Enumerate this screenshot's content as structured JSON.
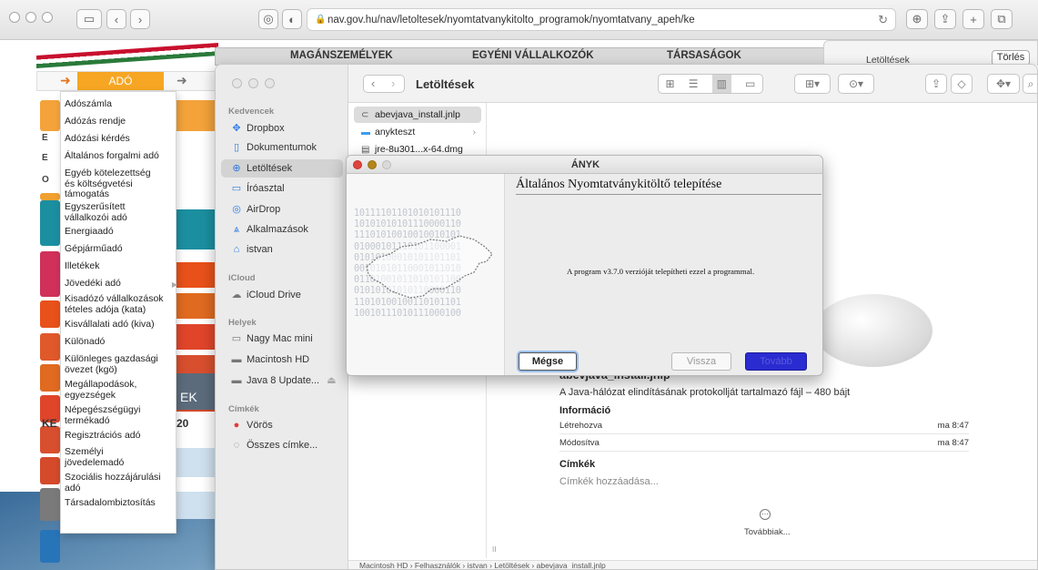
{
  "browser": {
    "url": "nav.gov.hu/nav/letoltesek/nyomtatvanykitolto_programok/nyomtatvany_apeh/ke"
  },
  "downloads_popover": {
    "title": "Letöltések",
    "clear_label": "Törlés"
  },
  "site": {
    "nav_items": [
      "MAGÁNSZEMÉLYEK",
      "EGYÉNI VÁLLALKOZÓK",
      "TÁRSASÁGOK"
    ],
    "ado_tab": "ADÓ",
    "side_letters": [
      "E",
      "E",
      "O"
    ],
    "fragments": [
      "KE",
      "20",
      "EK"
    ]
  },
  "menu": {
    "items": [
      "Adószámla",
      "Adózás rendje",
      "Adózási kérdés",
      "Általános forgalmi adó",
      "Egyéb kötelezettség és költségvetési támogatás",
      "Egyszerűsített vállalkozói adó",
      "Energiaadó",
      "Gépjárműadó",
      "Illetékek",
      "Jövedéki adó",
      "Kisadózó vállalkozások tételes adója (kata)",
      "Kisvállalati adó (kiva)",
      "Különadó",
      "Különleges gazdasági övezet (kgö)",
      "Megállapodások, egyezségek",
      "Népegészségügyi termékadó",
      "Regisztrációs adó",
      "Személyi jövedelemadó",
      "Szociális hozzájárulási adó",
      "Társadalombiztosítás"
    ]
  },
  "finder": {
    "title": "Letöltések",
    "sidebar": {
      "favorites_header": "Kedvencek",
      "favorites": [
        "Dropbox",
        "Dokumentumok",
        "Letöltések",
        "Íróasztal",
        "AirDrop",
        "Alkalmazások",
        "istvan"
      ],
      "icloud_header": "iCloud",
      "icloud": [
        "iCloud Drive"
      ],
      "places_header": "Helyek",
      "places": [
        "Nagy Mac mini",
        "Macintosh HD",
        "Java 8 Update..."
      ],
      "tags_header": "Címkék",
      "tags": [
        "Vörös",
        "Összes címke..."
      ]
    },
    "files": [
      "abevjava_install.jnlp",
      "anykteszt",
      "jre-8u301...x-64.dmg"
    ],
    "preview": {
      "file_name": "abevjava_install.jnlp",
      "description": "A Java-hálózat elindításának protokollját tartalmazó fájl – 480 bájt",
      "info_header": "Információ",
      "created_label": "Létrehozva",
      "created_value": "ma 8:47",
      "modified_label": "Módosítva",
      "modified_value": "ma 8:47",
      "tags_header": "Címkék",
      "tags_add": "Címkék hozzáadása...",
      "more_label": "Továbbiak..."
    },
    "path_bar": "Macintosh HD › Felhasználók › istvan › Letöltések › abevjava_install.jnlp"
  },
  "dialog": {
    "title": "ÁNYK",
    "heading": "Általános Nyomtatványkitöltő telepítése",
    "message": "A program v3.7.0 verzióját telepítheti ezzel a programmal.",
    "binary_text": "10111101101010101110\n10101010101110000110\n11101010010010010101\n01000101110101100001\n01010100010101101101\n00101010110001011010\n01101001011010101100\n01010101010110000110\n11010100100110101101\n10010111010111000100",
    "btn_cancel": "Mégse",
    "btn_back": "Vissza",
    "btn_next": "Tovább"
  },
  "colors": {
    "accent_orange": "#f6a623",
    "dialog_next_blue": "#2a2bd0",
    "traffic_red": "#e0443e",
    "traffic_yellow": "#b5851b"
  }
}
